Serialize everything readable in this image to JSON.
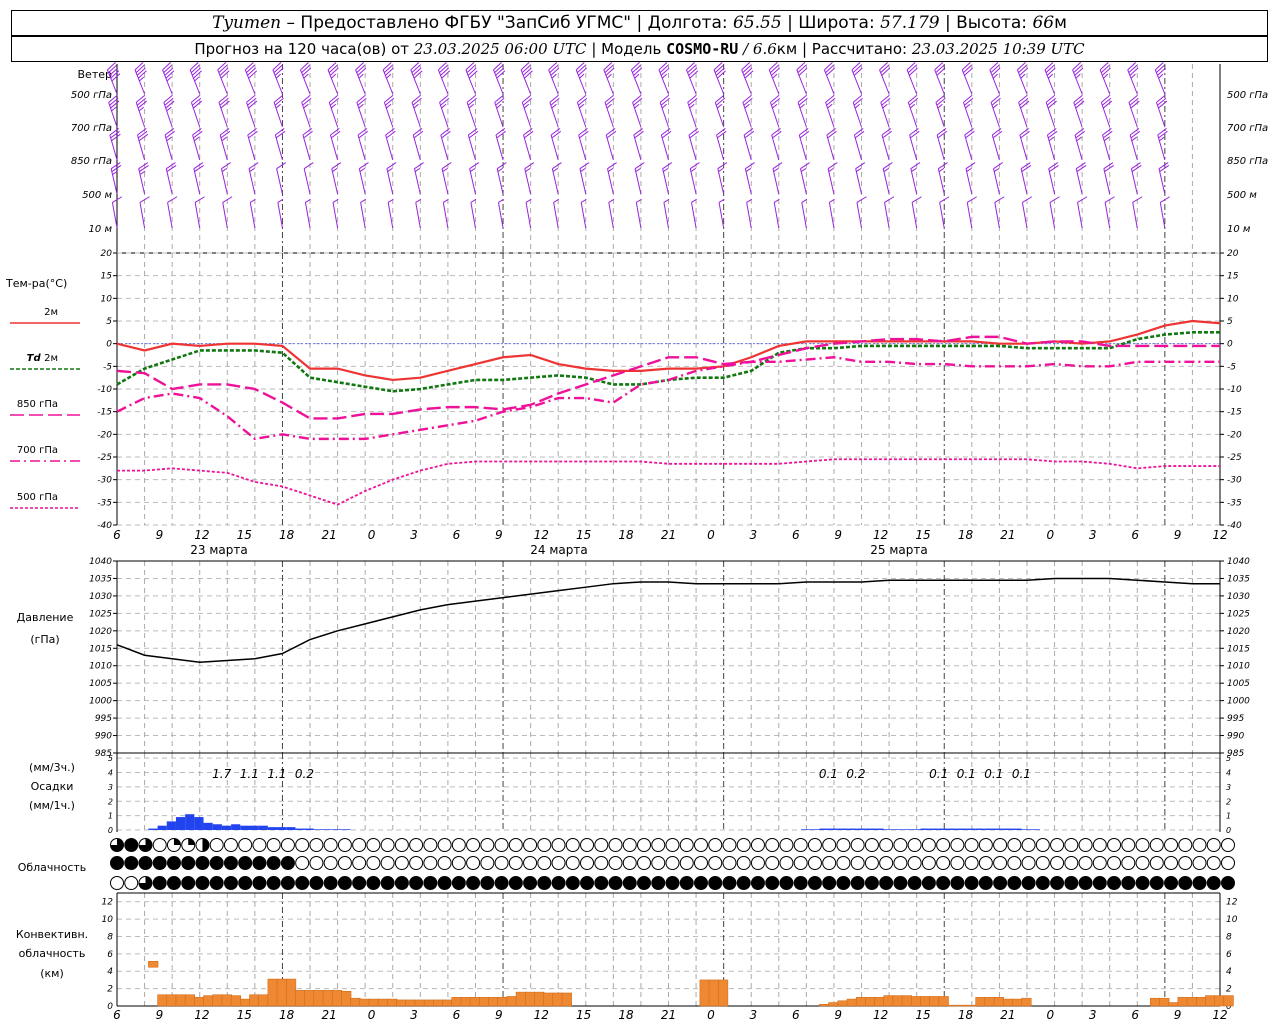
{
  "header": {
    "station": "Tyumen",
    "provider": "– Предоставлено ФГБУ \"ЗапСиб УГМС\"",
    "lon_label": "Долгота:",
    "lon": "65.55",
    "lat_label": "Широта:",
    "lat": "57.179",
    "alt_label": "Высота:",
    "alt": "66",
    "alt_unit": "м",
    "fc_label": "Прогноз на 120 часа(ов) от",
    "fc_time": "23.03.2025 06:00 UTC",
    "model_label": "Модель",
    "model": "COSMO-RU",
    "res": "/ 6.6",
    "res_unit": "км",
    "calc_label": "Рассчитано:",
    "calc_time": "23.03.2025 10:39 UTC"
  },
  "time_axis": {
    "hour_labels": [
      "6",
      "9",
      "12",
      "15",
      "18",
      "21",
      "0",
      "3",
      "6",
      "9",
      "12",
      "15",
      "18",
      "21",
      "0",
      "3",
      "6",
      "9",
      "12",
      "15",
      "18",
      "21",
      "0",
      "3",
      "6",
      "9",
      "12"
    ],
    "dates": [
      "23 марта",
      "24 марта",
      "25 марта"
    ]
  },
  "wind_panel": {
    "title": "Ветер",
    "levels": [
      "500 гПа",
      "700 гПа",
      "850 гПа",
      "500 м",
      "10 м"
    ],
    "color": "#9922dd"
  },
  "temp_panel": {
    "title": "Тем-ра(°C)",
    "legend": [
      {
        "label": "2м",
        "italic_prefix": "",
        "color": "#ee3333",
        "dash": ""
      },
      {
        "label": "2м",
        "italic_prefix": "Td",
        "color": "#117711",
        "dash": "4,2"
      },
      {
        "label": "850 гПа",
        "italic_prefix": "",
        "color": "#ee1199",
        "dash": "14,5"
      },
      {
        "label": "700 гПа",
        "italic_prefix": "",
        "color": "#ee1199",
        "dash": "10,4,2,4"
      },
      {
        "label": "500 гПа",
        "italic_prefix": "",
        "color": "#ee1199",
        "dash": "3,2"
      }
    ],
    "y_ticks": [
      "20",
      "15",
      "10",
      "5",
      "0",
      "-5",
      "-10",
      "-15",
      "-20",
      "-25",
      "-30",
      "-35",
      "-40"
    ]
  },
  "pressure_panel": {
    "title": "Давление",
    "unit": "(гПа)",
    "y_ticks": [
      "1040",
      "1035",
      "1030",
      "1025",
      "1020",
      "1015",
      "1010",
      "1005",
      "1000",
      "995",
      "990",
      "985"
    ]
  },
  "precip_panel": {
    "unit_3h": "(мм/3ч.)",
    "title": "Осадки",
    "unit_1h": "(мм/1ч.)",
    "y_ticks": [
      "5",
      "4",
      "3",
      "2",
      "1",
      "0"
    ],
    "totals": [
      {
        "h": 9,
        "text": "1.7"
      },
      {
        "h": 12,
        "text": "1.1"
      },
      {
        "h": 15,
        "text": "1.1"
      },
      {
        "h": 18,
        "text": "0.2"
      },
      {
        "h": 75,
        "text": "0.1"
      },
      {
        "h": 78,
        "text": "0.2"
      },
      {
        "h": 87,
        "text": "0.1"
      },
      {
        "h": 90,
        "text": "0.1"
      },
      {
        "h": 93,
        "text": "0.1"
      },
      {
        "h": 96,
        "text": "0.1"
      }
    ]
  },
  "cloud_panel": {
    "title": "Облачность",
    "rows": [
      "34301120000000000000000000000000000000000000000000000000000000000000000000000000000000000000000000000000000000000000000000",
      "44444444444440000000000000000000000000000000000000000000000000000000000000000000000000000000000000000000000000000000000000",
      "00344444444444444444444444444444444444444444444444444444444444444444444444444444444444444444444444444444444444444444444444"
    ]
  },
  "conv_panel": {
    "title_1": "Конвективн.",
    "title_2": "облачность",
    "unit": "(км)",
    "y_ticks": [
      "12",
      "10",
      "8",
      "6",
      "4",
      "2",
      "0"
    ],
    "color": "#ee8833"
  },
  "chart_data": [
    {
      "type": "barbs",
      "title": "Ветер",
      "levels": [
        "500 гПа",
        "700 гПа",
        "850 гПа",
        "500 м",
        "10 м"
      ],
      "x_hours_from_start": [
        0,
        3,
        6,
        9,
        12,
        15,
        18,
        21,
        24,
        27,
        30,
        33,
        36,
        39,
        42,
        45,
        48,
        51,
        54,
        57,
        60,
        63,
        66,
        69,
        72,
        75,
        78,
        81,
        84,
        87,
        90,
        93,
        96,
        99,
        102,
        105,
        108,
        111,
        114
      ],
      "speed_kt": {
        "500 гПа": [
          50,
          45,
          45,
          45,
          40,
          40,
          35,
          35,
          35,
          35,
          35,
          40,
          40,
          40,
          40,
          40,
          35,
          35,
          35,
          35,
          35,
          40,
          40,
          40,
          35,
          30,
          30,
          30,
          30,
          30,
          30,
          30,
          35,
          35,
          35,
          35,
          35,
          35,
          35
        ],
        "700 гПа": [
          35,
          35,
          35,
          30,
          30,
          30,
          25,
          25,
          25,
          25,
          25,
          25,
          25,
          25,
          25,
          25,
          25,
          25,
          25,
          25,
          25,
          25,
          25,
          25,
          25,
          25,
          25,
          25,
          25,
          25,
          25,
          25,
          25,
          30,
          30,
          30,
          30,
          30,
          30
        ],
        "850 гПа": [
          30,
          30,
          25,
          25,
          25,
          20,
          20,
          20,
          20,
          20,
          20,
          20,
          20,
          20,
          20,
          20,
          20,
          20,
          20,
          20,
          20,
          20,
          20,
          20,
          20,
          20,
          20,
          20,
          20,
          20,
          20,
          20,
          20,
          20,
          25,
          25,
          25,
          25,
          25
        ],
        "500 м": [
          25,
          25,
          20,
          20,
          15,
          15,
          10,
          10,
          15,
          15,
          15,
          15,
          15,
          15,
          15,
          15,
          15,
          15,
          15,
          15,
          15,
          15,
          15,
          15,
          15,
          15,
          15,
          15,
          15,
          15,
          15,
          15,
          15,
          20,
          20,
          20,
          20,
          20,
          20
        ],
        "10 м": [
          10,
          10,
          10,
          10,
          10,
          5,
          5,
          5,
          5,
          5,
          5,
          5,
          5,
          5,
          5,
          5,
          5,
          5,
          5,
          5,
          5,
          5,
          5,
          5,
          5,
          5,
          5,
          10,
          10,
          10,
          10,
          10,
          10,
          10,
          10,
          10,
          10,
          10,
          10
        ]
      }
    },
    {
      "type": "line",
      "title": "Тем-ра(°C)",
      "x_label": "hours from 23.03 06:00 UTC",
      "ylim": [
        -40,
        20
      ],
      "x": [
        0,
        3,
        6,
        9,
        12,
        15,
        18,
        21,
        24,
        27,
        30,
        33,
        36,
        39,
        42,
        45,
        48,
        51,
        54,
        57,
        60,
        63,
        66,
        69,
        72,
        75,
        78,
        81,
        84,
        87,
        90,
        93,
        96,
        99,
        102,
        105,
        108,
        111,
        114,
        117,
        120
      ],
      "series": [
        {
          "name": "2м",
          "values": [
            0,
            -1.5,
            0,
            -0.5,
            0,
            0,
            -0.5,
            -5.5,
            -5.5,
            -7,
            -8,
            -7.5,
            -6,
            -4.5,
            -3,
            -2.5,
            -4.5,
            -5.5,
            -6,
            -6,
            -5.5,
            -5.5,
            -5,
            -3,
            -0.5,
            0.5,
            0.5,
            0.5,
            0.5,
            0.5,
            0.5,
            0.5,
            0,
            0,
            0.5,
            0,
            0.5,
            2,
            4,
            5,
            4.5
          ]
        },
        {
          "name": "Td 2м",
          "values": [
            -9,
            -5.5,
            -3.5,
            -1.5,
            -1.5,
            -1.5,
            -2,
            -7.5,
            -8.5,
            -9.5,
            -10.5,
            -10,
            -9,
            -8,
            -8,
            -7.5,
            -7,
            -7.5,
            -9,
            -9,
            -8,
            -7.5,
            -7.5,
            -6,
            -2,
            -1,
            -1,
            -0.5,
            -0.5,
            -0.5,
            -0.5,
            -0.5,
            -0.5,
            -1,
            -1,
            -1,
            -1,
            1,
            2,
            2.5,
            2.5
          ]
        },
        {
          "name": "850 гПа",
          "values": [
            -6,
            -6.5,
            -10,
            -9,
            -9,
            -10,
            -13,
            -16.5,
            -16.5,
            -15.5,
            -15.5,
            -14.5,
            -14,
            -14,
            -14.5,
            -13.5,
            -11,
            -9,
            -7,
            -5,
            -3,
            -3,
            -4.5,
            -4,
            -2.5,
            -1,
            0,
            0.5,
            1,
            1,
            0.5,
            1.5,
            1.5,
            0,
            0.5,
            0.5,
            -0.5,
            -0.5,
            -0.5,
            -0.5,
            -0.5
          ]
        },
        {
          "name": "700 гПа",
          "values": [
            -15,
            -12,
            -11,
            -12,
            -16,
            -21,
            -20,
            -21,
            -21,
            -21,
            -20,
            -19,
            -18,
            -17,
            -15,
            -14,
            -12,
            -12,
            -13,
            -9,
            -8,
            -6,
            -5,
            -4,
            -4,
            -3.5,
            -3,
            -4,
            -4,
            -4.5,
            -4.5,
            -5,
            -5,
            -5,
            -4.5,
            -5,
            -5,
            -4,
            -4,
            -4,
            -4
          ]
        },
        {
          "name": "500 гПа",
          "values": [
            -28,
            -28,
            -27.5,
            -28,
            -28.5,
            -30.5,
            -31.5,
            -33.5,
            -35.5,
            -32.5,
            -30,
            -28,
            -26.5,
            -26,
            -26,
            -26,
            -26,
            -26,
            -26,
            -26,
            -26.5,
            -26.5,
            -26.5,
            -26.5,
            -26.5,
            -26,
            -25.5,
            -25.5,
            -25.5,
            -25.5,
            -25.5,
            -25.5,
            -25.5,
            -25.5,
            -26,
            -26,
            -26.5,
            -27.5,
            -27,
            -27,
            -27
          ]
        }
      ]
    },
    {
      "type": "line",
      "title": "Давление (гПа)",
      "ylim": [
        985,
        1040
      ],
      "x": [
        0,
        3,
        6,
        9,
        12,
        15,
        18,
        21,
        24,
        27,
        30,
        33,
        36,
        39,
        42,
        45,
        48,
        51,
        54,
        57,
        60,
        63,
        66,
        69,
        72,
        75,
        78,
        81,
        84,
        87,
        90,
        93,
        96,
        99,
        102,
        105,
        108,
        111,
        114,
        117,
        120
      ],
      "series": [
        {
          "name": "Давление",
          "values": [
            1016,
            1013,
            1012,
            1011,
            1011.5,
            1012,
            1013.5,
            1017.5,
            1020,
            1022,
            1024,
            1026,
            1027.5,
            1028.5,
            1029.5,
            1030.5,
            1031.5,
            1032.5,
            1033.5,
            1034,
            1034,
            1033.5,
            1033.5,
            1033.5,
            1033.5,
            1034,
            1034,
            1034,
            1034.5,
            1034.5,
            1034.5,
            1034.5,
            1034.5,
            1034.5,
            1035,
            1035,
            1035,
            1034.5,
            1034,
            1033.5,
            1033.5
          ]
        }
      ]
    },
    {
      "type": "bar",
      "title": "Осадки",
      "x_hours": [
        2,
        3,
        4,
        5,
        6,
        7,
        8,
        9,
        10,
        11,
        12,
        13,
        14,
        15,
        16,
        17,
        18,
        19,
        20,
        21,
        22,
        23,
        73,
        74,
        75,
        76,
        77,
        78,
        79,
        80,
        81,
        82,
        83,
        84,
        85,
        86,
        87,
        88,
        89,
        90,
        91,
        92,
        93,
        94,
        95,
        96,
        97,
        98
      ],
      "values_mm_1h": [
        0.1,
        0.3,
        0.6,
        0.9,
        1.1,
        0.9,
        0.5,
        0.4,
        0.3,
        0.4,
        0.3,
        0.3,
        0.3,
        0.2,
        0.2,
        0.2,
        0.1,
        0.1,
        0.05,
        0.05,
        0.05,
        0.05,
        0.05,
        0.05,
        0.1,
        0.1,
        0.1,
        0.1,
        0.1,
        0.1,
        0.1,
        0.05,
        0.05,
        0.05,
        0.05,
        0.1,
        0.1,
        0.1,
        0.1,
        0.1,
        0.1,
        0.1,
        0.1,
        0.1,
        0.1,
        0.1,
        0.05,
        0.05
      ]
    },
    {
      "type": "bar",
      "title": "Конвективн. облачность (км)",
      "ylim": [
        0,
        13
      ],
      "x_hours": [
        2,
        3,
        4,
        5,
        6,
        7,
        8,
        9,
        10,
        11,
        12,
        13,
        14,
        15,
        16,
        17,
        18,
        19,
        20,
        21,
        22,
        23,
        24,
        25,
        26,
        27,
        28,
        29,
        30,
        31,
        32,
        33,
        34,
        35,
        36,
        37,
        38,
        39,
        40,
        41,
        42,
        43,
        44,
        45,
        46,
        47,
        62,
        63,
        64,
        75,
        76,
        77,
        78,
        79,
        80,
        81,
        82,
        83,
        84,
        85,
        86,
        87,
        88,
        89,
        90,
        91,
        92,
        93,
        94,
        95,
        96,
        97,
        111,
        112,
        113,
        114,
        115,
        116,
        117,
        118,
        119
      ],
      "values_km": [
        4.8,
        1.3,
        1.3,
        1.3,
        1.3,
        1.0,
        1.2,
        1.3,
        1.3,
        1.2,
        0.8,
        1.3,
        1.3,
        3.1,
        3.1,
        3.1,
        1.8,
        1.8,
        1.8,
        1.8,
        1.8,
        1.7,
        0.9,
        0.8,
        0.8,
        0.8,
        0.8,
        0.7,
        0.7,
        0.7,
        0.7,
        0.7,
        0.7,
        1.0,
        1.0,
        1.0,
        1.0,
        1.0,
        1.0,
        1.1,
        1.6,
        1.6,
        1.6,
        1.5,
        1.5,
        1.5,
        3.0,
        3.0,
        3.0,
        0.2,
        0.4,
        0.6,
        0.8,
        1.0,
        1.0,
        1.0,
        1.2,
        1.2,
        1.2,
        1.1,
        1.1,
        1.1,
        1.1,
        0.1,
        0.1,
        0.1,
        1.0,
        1.0,
        1.0,
        0.8,
        0.8,
        0.9,
        0.9,
        0.9,
        0.4,
        1.0,
        1.0,
        1.0,
        1.2,
        1.2,
        1.2
      ]
    }
  ]
}
